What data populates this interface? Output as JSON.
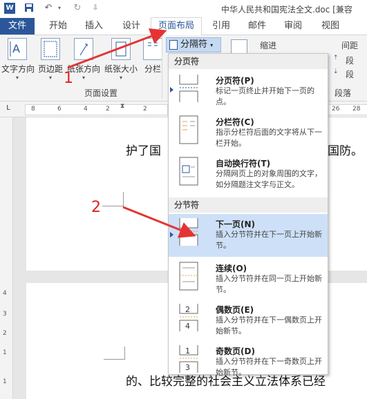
{
  "titlebar": {
    "title": "中华人民共和国宪法全文.doc [兼容",
    "icons": [
      "word-icon",
      "save-icon",
      "undo-icon",
      "redo-icon",
      "customize-icon"
    ]
  },
  "tabs": [
    {
      "label": "文件"
    },
    {
      "label": "开始"
    },
    {
      "label": "插入"
    },
    {
      "label": "设计"
    },
    {
      "label": "页面布局"
    },
    {
      "label": "引用"
    },
    {
      "label": "邮件"
    },
    {
      "label": "审阅"
    },
    {
      "label": "视图"
    }
  ],
  "ribbon": {
    "buttons": [
      {
        "label": "文字方向"
      },
      {
        "label": "页边距"
      },
      {
        "label": "纸张方向"
      },
      {
        "label": "纸张大小"
      },
      {
        "label": "分栏"
      }
    ],
    "group_label": "页面设置",
    "separator_button": "分隔符",
    "indent_label": "缩进",
    "spacing_label": "间距",
    "para_short_1": "段",
    "para_short_2": "段",
    "paragraph_group": "段落"
  },
  "ruler": {
    "ticks": [
      "8",
      "6",
      "4",
      "2",
      "2",
      "4",
      "6",
      "8",
      "10",
      "12",
      "14",
      "16",
      "18",
      "20",
      "22",
      "24",
      "26",
      "28"
    ],
    "corner": "L",
    "vertical_ticks": [
      "4",
      "3",
      "2",
      "1",
      "1"
    ]
  },
  "document": {
    "page1_left": "护了国",
    "page1_right": "国防。",
    "page2_text": "的、比较完整的社会主义立法体系已经"
  },
  "dropdown": {
    "section_page": "分页符",
    "section_section": "分节符",
    "items": [
      {
        "title": "分页符(P)",
        "desc": "标记一页终止并开始下一页的点。"
      },
      {
        "title": "分栏符(C)",
        "desc": "指示分栏符后面的文字将从下一栏开始。"
      },
      {
        "title": "自动换行符(T)",
        "desc": "分隔网页上的对象周围的文字，如分隔题注文字与正文。"
      },
      {
        "title": "下一页(N)",
        "desc": "插入分节符并在下一页上开始新节。"
      },
      {
        "title": "连续(O)",
        "desc": "插入分节符并在同一页上开始新节。"
      },
      {
        "title": "偶数页(E)",
        "desc": "插入分节符并在下一偶数页上开始新节。"
      },
      {
        "title": "奇数页(D)",
        "desc": "插入分节符并在下一奇数页上开始新节。"
      }
    ],
    "icon_digits": [
      "2",
      "4",
      "1",
      "3"
    ]
  },
  "annotations": {
    "step1": "1",
    "step2": "2",
    "arrow_color": "#e53333"
  },
  "colors": {
    "accent": "#2b579a",
    "highlight": "#cde0f7"
  }
}
